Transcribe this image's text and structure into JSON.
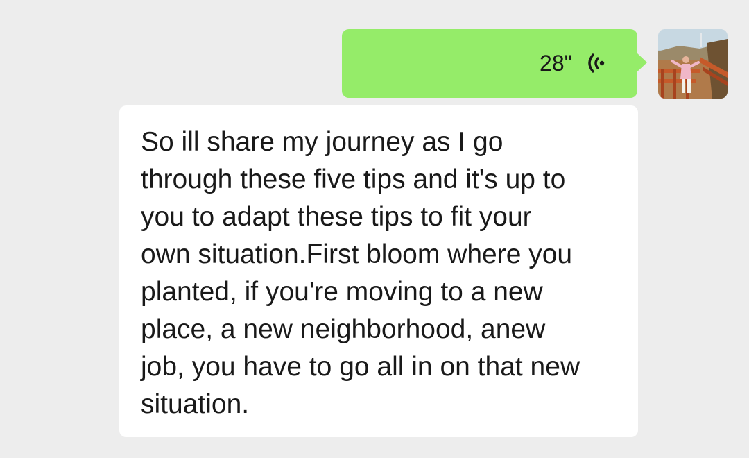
{
  "chat": {
    "voice_message": {
      "duration": "28\"",
      "icon": "voice-wave-icon",
      "bubble_color": "#95ec69"
    },
    "avatar": {
      "icon": "user-avatar-photo"
    },
    "transcript": {
      "lines": [
        "So ill share my journey as I go",
        "through these five tips and it's up to",
        "you to adapt these tips to fit your",
        "own situation.First bloom where you",
        "planted, if you're moving to a new",
        "place, a new neighborhood, anew",
        "job, you have to go all in on that new",
        "situation."
      ]
    },
    "background_color": "#ededed"
  }
}
